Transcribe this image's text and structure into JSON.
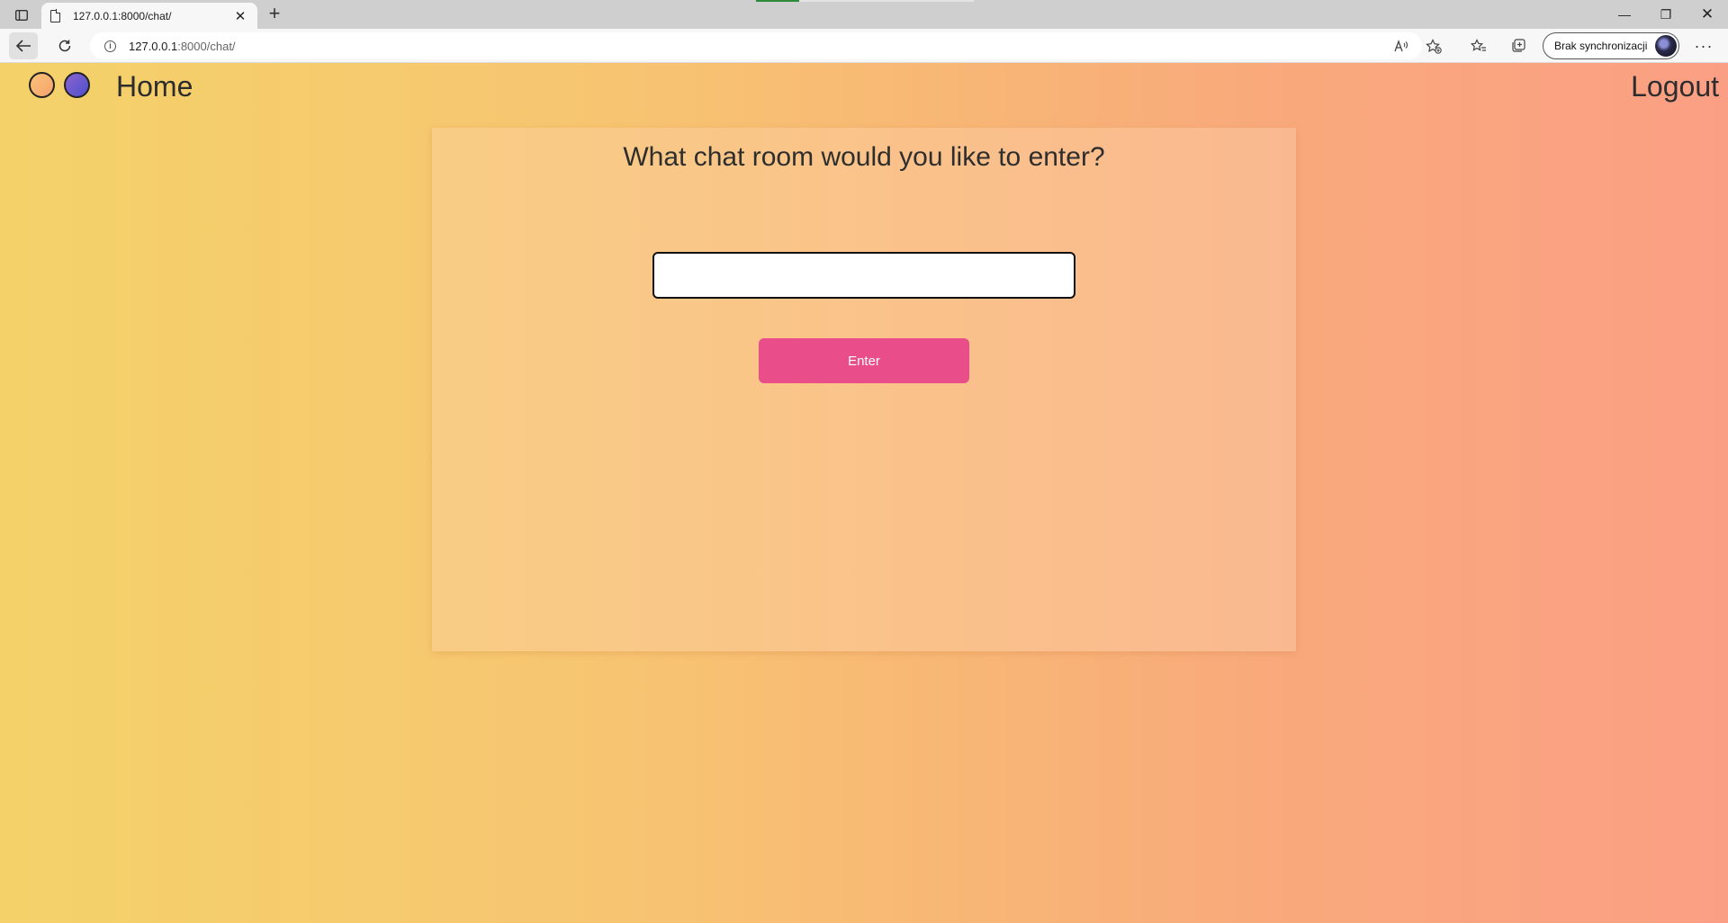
{
  "browser": {
    "tab_title": "127.0.0.1:8000/chat/",
    "url_host": "127.0.0.1",
    "url_rest": ":8000/chat/",
    "profile_label": "Brak synchronizacji"
  },
  "navbar": {
    "home_label": "Home",
    "logout_label": "Logout"
  },
  "main": {
    "title": "What chat room would you like to enter?",
    "room_input_value": "",
    "enter_label": "Enter"
  },
  "colors": {
    "gradient_start": "#f4d269",
    "gradient_end": "#fb9f84",
    "button": "#e94d8a"
  }
}
